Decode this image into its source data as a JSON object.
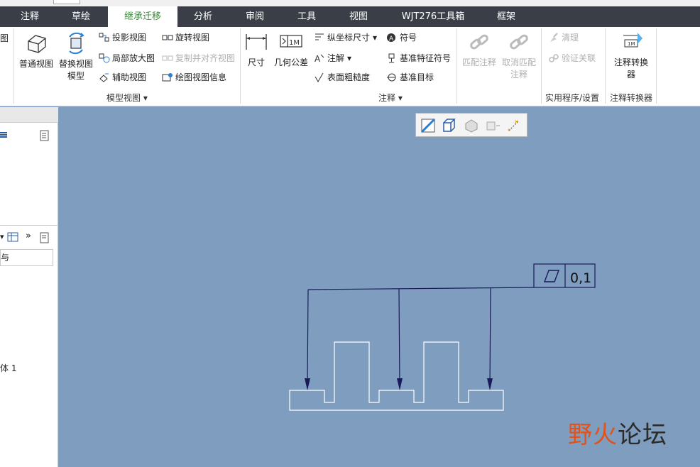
{
  "tabs": [
    {
      "label": "注释",
      "active": false
    },
    {
      "label": "草绘",
      "active": false
    },
    {
      "label": "继承迁移",
      "active": true
    },
    {
      "label": "分析",
      "active": false
    },
    {
      "label": "审阅",
      "active": false
    },
    {
      "label": "工具",
      "active": false
    },
    {
      "label": "视图",
      "active": false
    },
    {
      "label": "WJT276工具箱",
      "active": false
    },
    {
      "label": "框架",
      "active": false
    }
  ],
  "ribbon": {
    "partial_left": "图",
    "model_views": {
      "normal_view": "普通视图",
      "replace_view": "替换视图模型",
      "projection_view": "投影视图",
      "detail_view": "局部放大图",
      "auxiliary_view": "辅助视图",
      "revolved_view": "旋转视图",
      "copy_align_view": "复制并对齐视图",
      "drawing_view_info": "绘图视图信息",
      "group_label": "模型视图"
    },
    "annotations": {
      "dimension": "尺寸",
      "gtol": "几何公差",
      "ordinate_dim": "纵坐标尺寸",
      "note": "注解",
      "surface_finish": "表面粗糙度",
      "symbol": "符号",
      "datum_feature_symbol": "基准特征符号",
      "datum_target": "基准目标",
      "group_label": "注释"
    },
    "matching": {
      "match_annotation": "匹配注释",
      "cancel_match": "取消匹配注释"
    },
    "utilities": {
      "cleanup": "清理",
      "verify_assoc": "验证关联",
      "group_label": "实用程序/设置"
    },
    "converter": {
      "annotation_converter": "注释转换器",
      "group_label": "注释转换器"
    }
  },
  "left_panel": {
    "item_partial": "与",
    "body_label": "体 1"
  },
  "drawing": {
    "tolerance_value": "0,1",
    "tolerance_symbol": "flatness-parallelogram"
  },
  "watermark": {
    "part1": "野火",
    "part2": "论坛"
  },
  "colors": {
    "canvas": "#7e9dbf",
    "tabbar": "#3a3f47",
    "active_tab_text": "#3e8a3e",
    "leader": "#1a1a5a",
    "part_outline": "#ffffff"
  }
}
